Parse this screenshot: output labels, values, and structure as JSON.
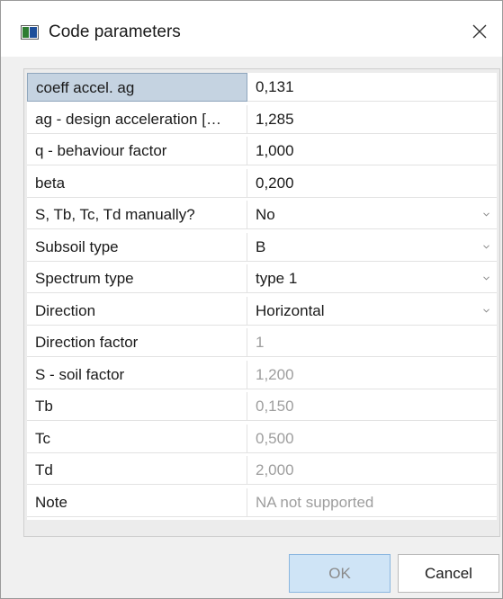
{
  "window": {
    "title": "Code parameters"
  },
  "icons": {
    "app": "window-app-icon",
    "close": "close-icon",
    "dropdown": "chevron-down-icon"
  },
  "colors": {
    "selected_cell": "#c5d3e1",
    "ok_button": "#cfe4f6",
    "disabled_text": "#9e9e9e"
  },
  "rows": [
    {
      "label": "coeff accel. ag",
      "value": "0,131",
      "selected": true
    },
    {
      "label": "ag - design acceleration […",
      "value": "1,285"
    },
    {
      "label": "q - behaviour factor",
      "value": "1,000"
    },
    {
      "label": "beta",
      "value": "0,200"
    },
    {
      "label": "S, Tb, Tc, Td manually?",
      "value": "No",
      "dropdown": true
    },
    {
      "label": "Subsoil type",
      "value": "B",
      "dropdown": true
    },
    {
      "label": "Spectrum type",
      "value": "type 1",
      "dropdown": true
    },
    {
      "label": "Direction",
      "value": "Horizontal",
      "dropdown": true
    },
    {
      "label": "Direction factor",
      "value": "1",
      "disabled": true
    },
    {
      "label": "S - soil factor",
      "value": "1,200",
      "disabled": true
    },
    {
      "label": "Tb",
      "value": "0,150",
      "disabled": true
    },
    {
      "label": "Tc",
      "value": "0,500",
      "disabled": true
    },
    {
      "label": "Td",
      "value": "2,000",
      "disabled": true
    },
    {
      "label": "Note",
      "value": "NA not supported",
      "disabled": true
    }
  ],
  "buttons": {
    "ok": "OK",
    "cancel": "Cancel"
  }
}
